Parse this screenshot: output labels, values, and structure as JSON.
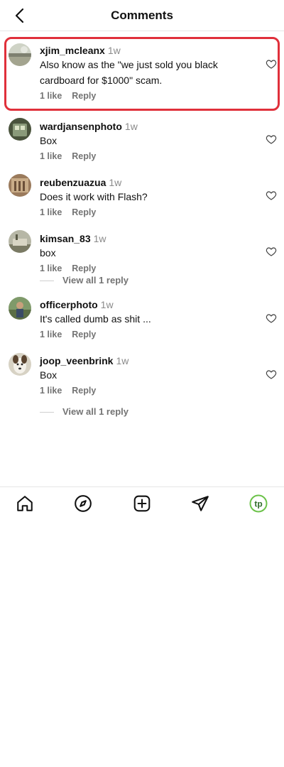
{
  "header": {
    "title": "Comments",
    "back_icon": "chevron-left-icon"
  },
  "comments": [
    {
      "username": "xjim_mcleanx",
      "time": "1w",
      "text": "Also know as the \"we just sold you black cardboard for $1000\" scam.",
      "likes": "1 like",
      "reply": "Reply",
      "highlighted": true
    },
    {
      "username": "wardjansenphoto",
      "time": "1w",
      "text": "Box",
      "likes": "1 like",
      "reply": "Reply"
    },
    {
      "username": "reubenzuazua",
      "time": "1w",
      "text": "Does it work with Flash?",
      "likes": "1 like",
      "reply": "Reply"
    },
    {
      "username": "kimsan_83",
      "time": "1w",
      "text": "box",
      "likes": "1 like",
      "reply": "Reply",
      "view_replies": "View all 1 reply"
    },
    {
      "username": "officerphoto",
      "time": "1w",
      "text": "It's called dumb as shit ...",
      "likes": "1 like",
      "reply": "Reply"
    },
    {
      "username": "joop_veenbrink",
      "time": "1w",
      "text": "Box",
      "likes": "1 like",
      "reply": "Reply",
      "view_replies": "View all 1 reply"
    }
  ],
  "bottom_nav": [
    "home-icon",
    "compass-icon",
    "add-post-icon",
    "send-icon",
    "profile-avatar"
  ],
  "profile_avatar_text": "tp",
  "colors": {
    "highlight": "#e0303b",
    "meta": "#737373",
    "accent_green": "#6cc24a"
  }
}
